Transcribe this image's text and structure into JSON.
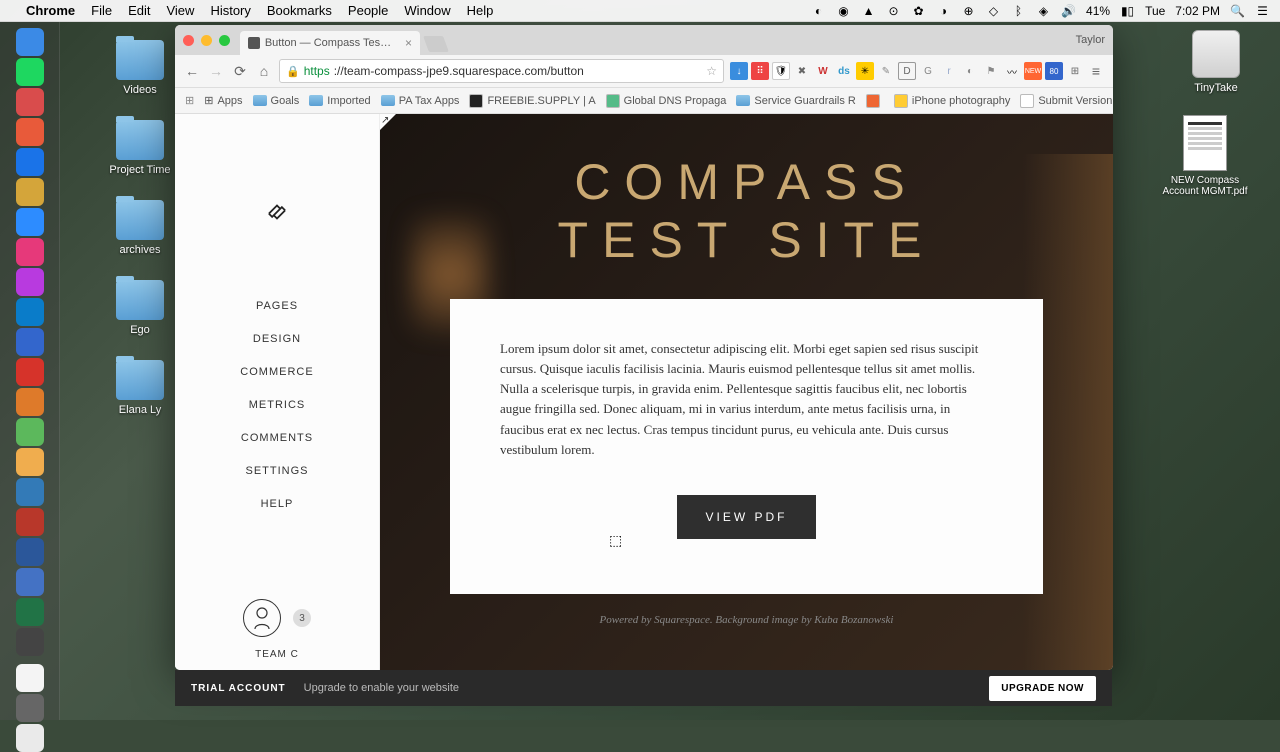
{
  "menubar": {
    "app": "Chrome",
    "menus": [
      "File",
      "Edit",
      "View",
      "History",
      "Bookmarks",
      "People",
      "Window",
      "Help"
    ],
    "battery": "41%",
    "day": "Tue",
    "time": "7:02 PM"
  },
  "desktop": {
    "folders": [
      "Videos",
      "Project Time",
      "archives",
      "Ego",
      "Elana Ly"
    ],
    "disk": "TinyTake",
    "file": "NEW Compass Account MGMT.pdf"
  },
  "chrome": {
    "tab_title": "Button — Compass Test Si",
    "user": "Taylor",
    "url_https": "https",
    "url_rest": "://team-compass-jpe9.squarespace.com/button",
    "bookmarks": [
      {
        "label": "Apps",
        "icon": "grid"
      },
      {
        "label": "Goals",
        "icon": "folder"
      },
      {
        "label": "Imported",
        "icon": "folder"
      },
      {
        "label": "PA Tax Apps",
        "icon": "folder"
      },
      {
        "label": "FREEBIE.SUPPLY | A",
        "icon": "fav",
        "color": "#222"
      },
      {
        "label": "Global DNS Propaga",
        "icon": "fav",
        "color": "#5b8"
      },
      {
        "label": "Service Guardrails R",
        "icon": "folder"
      },
      {
        "label": "",
        "icon": "fav",
        "color": "#e63"
      },
      {
        "label": "iPhone photography",
        "icon": "fav",
        "color": "#fc3"
      },
      {
        "label": "Submit Version",
        "icon": "fav",
        "color": "#fff"
      }
    ]
  },
  "squarespace": {
    "nav": [
      "PAGES",
      "DESIGN",
      "COMMERCE",
      "METRICS",
      "COMMENTS",
      "SETTINGS",
      "HELP"
    ],
    "badge": "3",
    "username": "TEAM C",
    "site_title_l1": "COMPASS",
    "site_title_l2": "TEST SITE",
    "body": "Lorem ipsum dolor sit amet, consectetur adipiscing elit. Morbi eget sapien sed risus suscipit cursus. Quisque iaculis facilisis lacinia. Mauris euismod pellentesque tellus sit amet mollis. Nulla a scelerisque turpis, in gravida enim. Pellentesque sagittis faucibus elit, nec lobortis augue fringilla sed. Donec aliquam, mi in varius interdum, ante metus facilisis urna, in faucibus erat ex nec lectus. Cras tempus tincidunt purus, eu vehicula ante. Duis cursus vestibulum lorem.",
    "button": "VIEW PDF",
    "footer": "Powered by Squarespace. Background image by Kuba Bozanowski"
  },
  "trial": {
    "label": "TRIAL ACCOUNT",
    "msg": "Upgrade to enable your website",
    "cta": "UPGRADE NOW"
  },
  "dock_colors": [
    "#3b8ae6",
    "#1ed760",
    "#d94c4c",
    "#e85a3a",
    "#1a73e8",
    "#d4a53a",
    "#2d8cff",
    "#e6397a",
    "#b83adf",
    "#0a7cc9",
    "#3366cc",
    "#d6332a",
    "#de7a2a",
    "#5cb85c",
    "#f0ad4e",
    "#337ab7",
    "#b8372a",
    "#2b579a",
    "#4472c4",
    "#217346",
    "#444",
    "#f4f4f4",
    "#666",
    "#eaeaea"
  ]
}
